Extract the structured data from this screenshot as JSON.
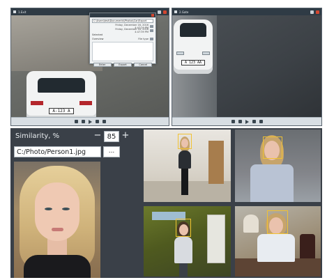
{
  "cameras": [
    {
      "name": "1.Exit",
      "timestamp": "",
      "plate": "A-123 A",
      "dialog": {
        "path": "C:\\Users\\test\\Documents\\Photos\\Car\\Export",
        "rows": [
          {
            "label": "",
            "value": "Friday, December 16, 2016  4:47:29 PM"
          },
          {
            "label": "",
            "value": "Friday, December 16, 2016  4:47:39 PM"
          },
          {
            "label": "Selected",
            "value": ""
          },
          {
            "label": "Overview",
            "value": "File type"
          }
        ],
        "buttons": [
          "Enter",
          "Export",
          "Cancel"
        ]
      }
    },
    {
      "name": "2.Gate",
      "timestamp": "",
      "plate": "A 123 AA"
    }
  ],
  "face_search": {
    "similarity_label": "Similarity, %",
    "minus_label": "−",
    "similarity_value": "85",
    "plus_label": "+",
    "photo_path": "C:/Photo/Person1.jpg",
    "browse_label": "..."
  },
  "colors": {
    "panel_bg": "#3a4048",
    "face_box": "#f1c232",
    "titlebar": "#2f3b45"
  }
}
